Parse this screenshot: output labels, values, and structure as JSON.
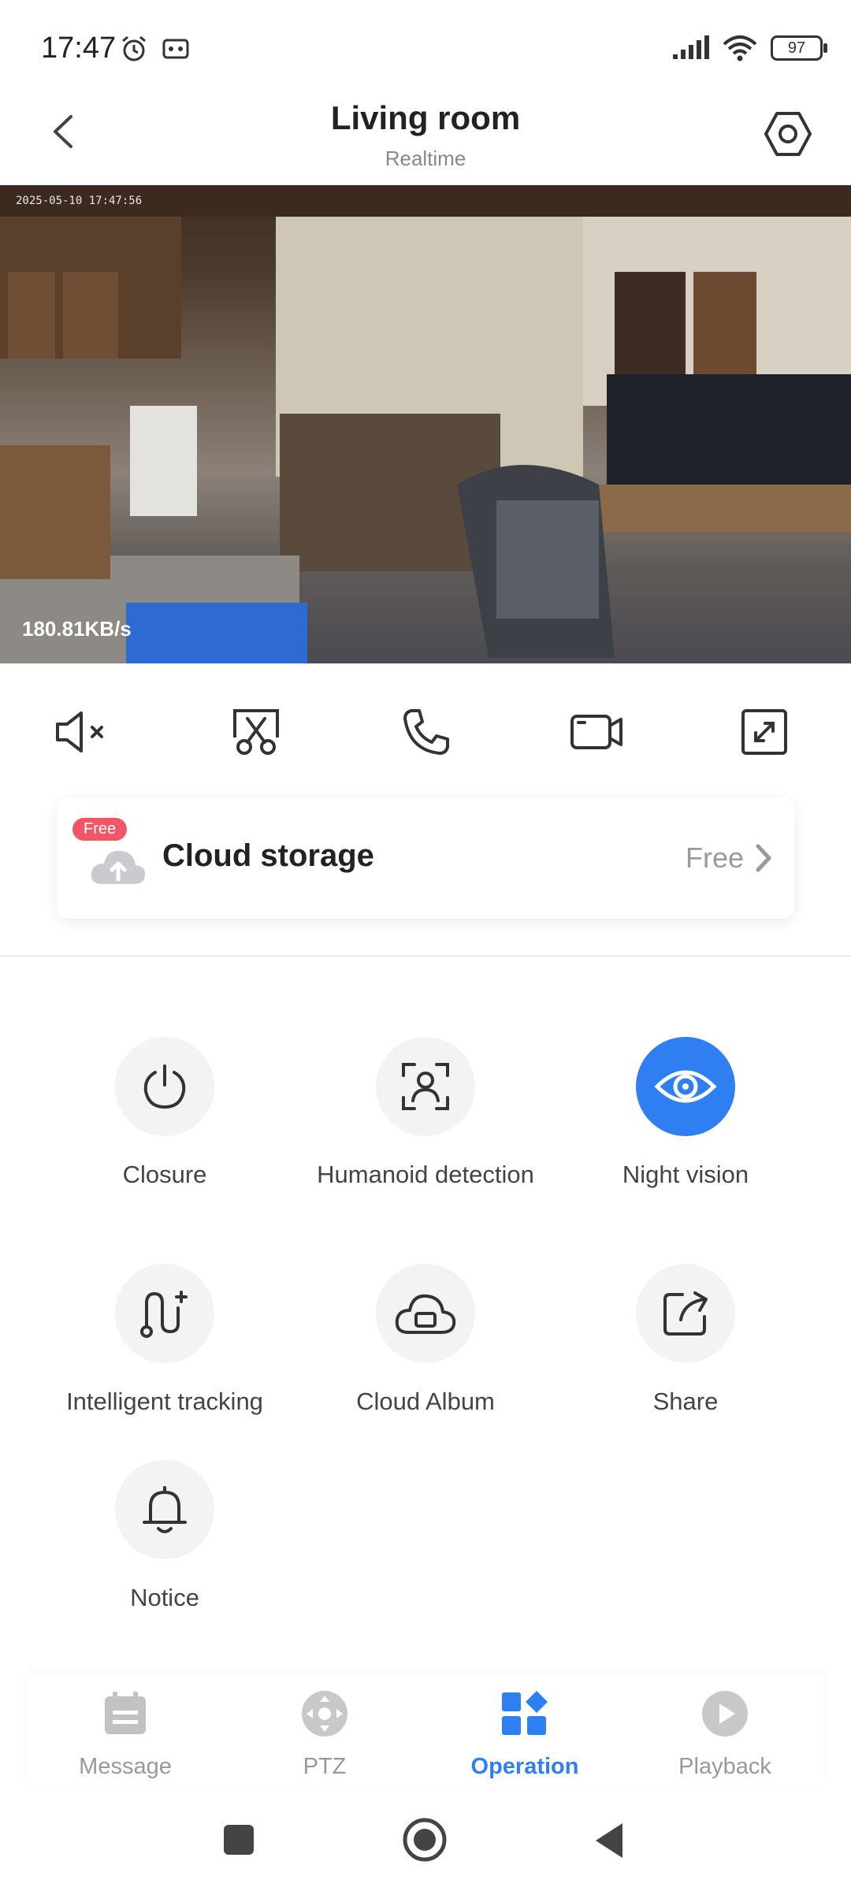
{
  "status_bar": {
    "time": "17:47",
    "battery": "97"
  },
  "header": {
    "title": "Living room",
    "subtitle": "Realtime"
  },
  "video": {
    "timestamp": "2025-05-10 17:47:56",
    "bitrate": "180.81KB/s"
  },
  "controls": [
    "mute-icon",
    "screenshot-icon",
    "phone-icon",
    "record-icon",
    "fullscreen-icon"
  ],
  "cloud_storage": {
    "badge": "Free",
    "label": "Cloud storage",
    "value": "Free"
  },
  "operations": [
    {
      "label": "Closure",
      "icon": "power-icon"
    },
    {
      "label": "Humanoid detection",
      "icon": "humanoid-icon"
    },
    {
      "label": "Night vision",
      "icon": "eye-icon",
      "active": true
    },
    {
      "label": "Intelligent tracking",
      "icon": "tracking-icon"
    },
    {
      "label": "Cloud Album",
      "icon": "cloud-album-icon"
    },
    {
      "label": "Share",
      "icon": "share-icon"
    },
    {
      "label": "Notice",
      "icon": "bell-icon"
    }
  ],
  "bottom_nav": [
    {
      "label": "Message"
    },
    {
      "label": "PTZ"
    },
    {
      "label": "Operation",
      "active": true
    },
    {
      "label": "Playback"
    }
  ],
  "colors": {
    "accent": "#2f7ff2",
    "badge": "#f15566",
    "inactive": "#999999"
  }
}
